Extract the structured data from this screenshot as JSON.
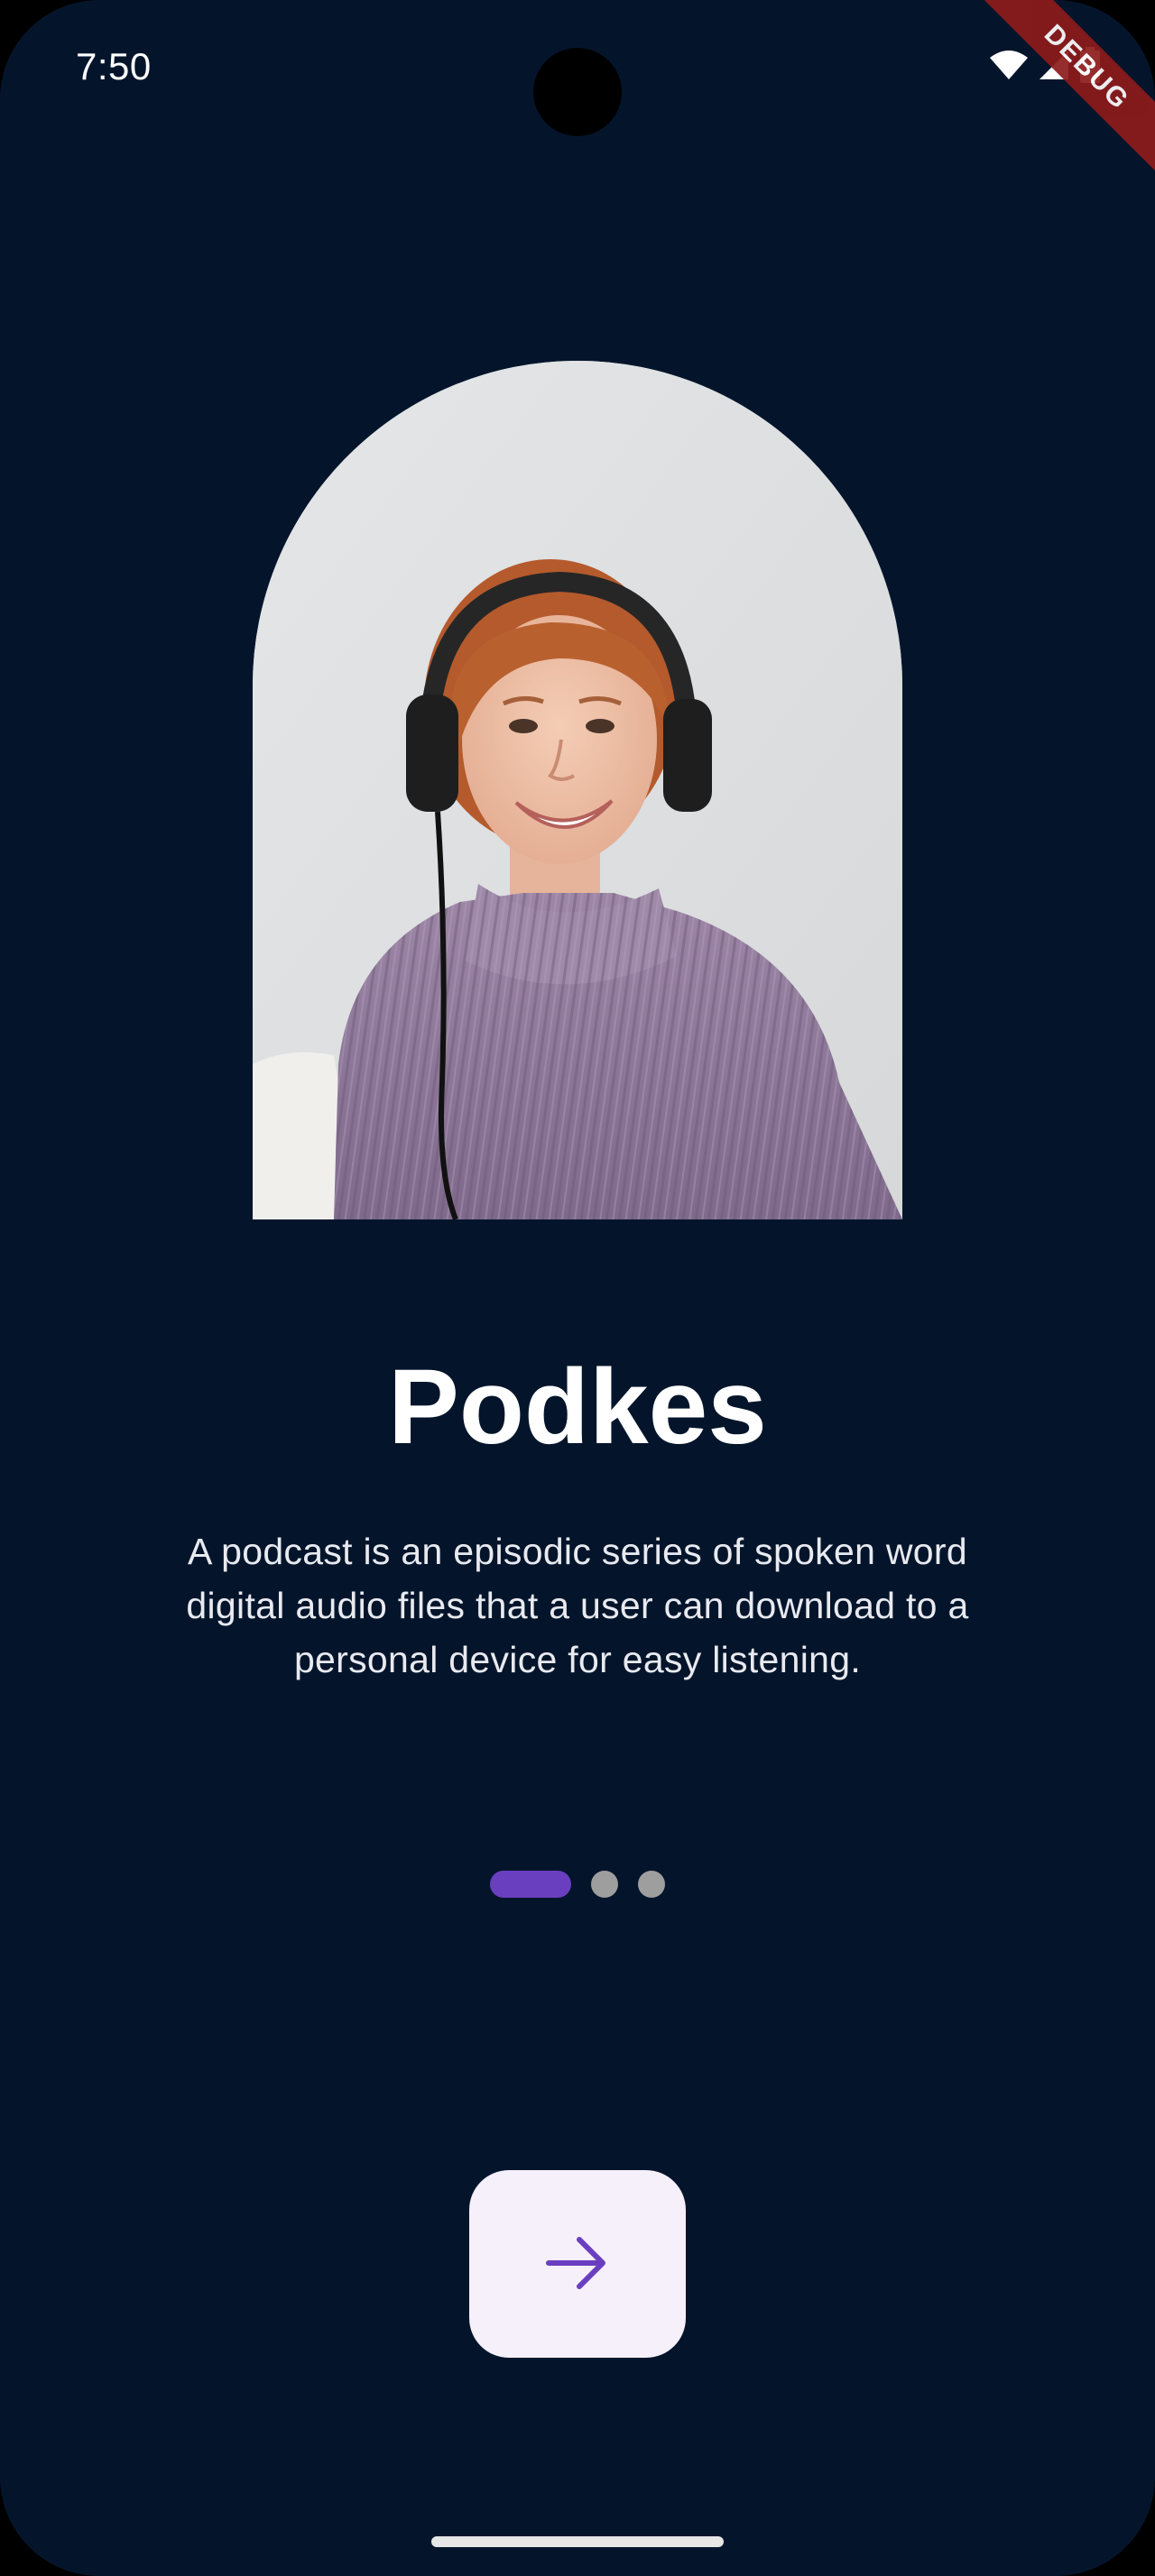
{
  "status_bar": {
    "time": "7:50",
    "icons": [
      "wifi-icon",
      "signal-icon",
      "battery-icon"
    ],
    "debug_label": "DEBUG"
  },
  "onboarding": {
    "hero_image": "podcast-listener-photo",
    "title": "Podkes",
    "description": "A podcast is an episodic series of spoken word digital audio files that a user can download to a personal device for easy listening.",
    "pages_total": 3,
    "current_page": 1,
    "next_button_icon": "arrow-right-icon"
  },
  "colors": {
    "background": "#04152b",
    "accent": "#6a3fbf",
    "inactive_dot": "#9e9e9e",
    "button_bg": "#f6f0fa",
    "debug_ribbon": "#8e1c1c"
  }
}
